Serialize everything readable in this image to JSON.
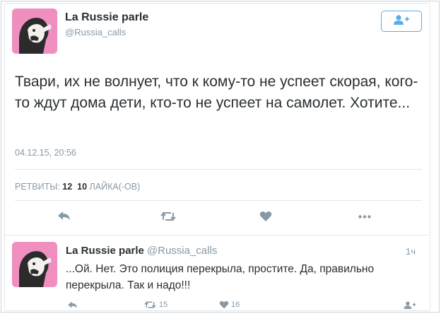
{
  "main_tweet": {
    "display_name": "La Russie parle",
    "handle": "@Russia_calls",
    "follow_icon": "add-user-icon",
    "text": "Твари, их не волнует, что к кому-то не успеет скорая, кого-то ждут дома дети, кто-то не успеет на самолет. Хотите...",
    "timestamp": "04.12.15, 20:56",
    "stats": {
      "retweets_label": "РЕТВИТЫ:",
      "retweets_count": "12",
      "likes_count": "10",
      "likes_label": "ЛАЙКА(-ОВ)"
    },
    "actions": [
      "reply-icon",
      "retweet-icon",
      "heart-icon",
      "more-icon"
    ]
  },
  "reply_tweet": {
    "display_name": "La Russie parle",
    "handle": "@Russia_calls",
    "time": "1ч",
    "text": "...Ой. Нет. Это полиция перекрыла, простите. Да, правильно перекрыла. Так и надо!!!",
    "retweet_count": "15",
    "like_count": "16"
  },
  "colors": {
    "avatar_bg": "#f08fbf",
    "accent": "#55acee",
    "icon_gray": "#8899a6"
  }
}
